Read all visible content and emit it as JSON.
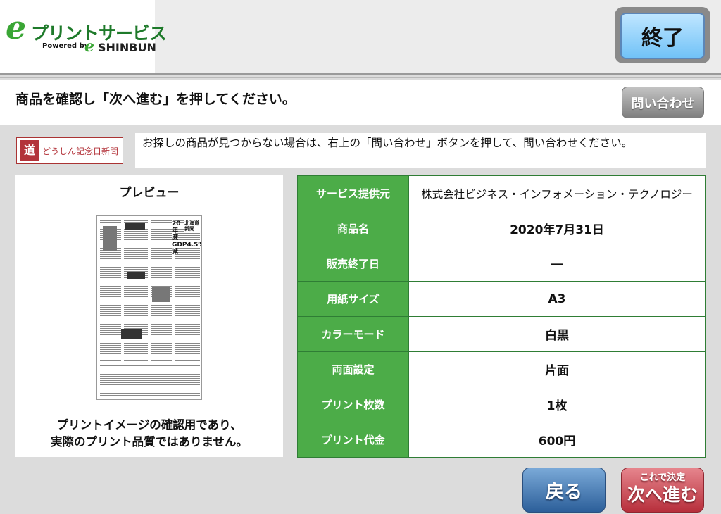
{
  "header": {
    "logo_e": "e",
    "logo_title": "プリントサービス",
    "logo_powered": "Powered by",
    "logo_e2": "e",
    "logo_shinbun": "SHINBUN",
    "end_label": "終了"
  },
  "instruction": "商品を確認し「次へ進む」を押してください。",
  "inquiry_label": "問い合わせ",
  "paper_logo": {
    "mark": "道",
    "name": "どうしん記念日新聞"
  },
  "notice": "お探しの商品が見つからない場合は、右上の「問い合わせ」ボタンを押して、問い合わせください。",
  "preview": {
    "title": "プレビュー",
    "thumb_headline1": "20年度GDP4.5%減",
    "thumb_masthead": "北海道新聞",
    "note_line1": "プリントイメージの確認用であり、",
    "note_line2": "実際のプリント品質ではありません。"
  },
  "details": [
    {
      "label": "サービス提供元",
      "value": "株式会社ビジネス・インフォメーション・テクノロジー"
    },
    {
      "label": "商品名",
      "value": "2020年7月31日"
    },
    {
      "label": "販売終了日",
      "value": "―"
    },
    {
      "label": "用紙サイズ",
      "value": "A3"
    },
    {
      "label": "カラーモード",
      "value": "白黒"
    },
    {
      "label": "両面設定",
      "value": "片面"
    },
    {
      "label": "プリント枚数",
      "value": "1枚"
    },
    {
      "label": "プリント代金",
      "value": "600円"
    }
  ],
  "buttons": {
    "back": "戻る",
    "next_sub": "これで決定",
    "next_main": "次へ進む"
  }
}
